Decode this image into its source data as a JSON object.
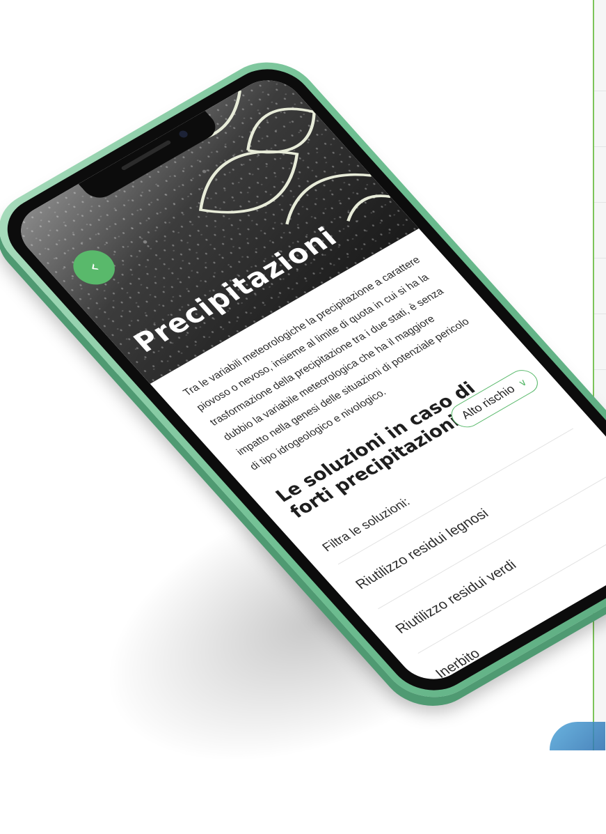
{
  "hero": {
    "title": "Precipitazioni",
    "back_icon": "chevron-left-icon"
  },
  "intro": "Tra le variabili meteorologiche la precipitazione a carattere piovoso o nevoso, insieme al limite di quota in cui si ha la trasformazione della precipitazione tra i due stati, è senza dubbio la variabile meteorologica che ha il maggiore impatto nella genesi delle situazioni di potenziale pericolo di tipo idrogeologico e nivologico.",
  "section": {
    "title": "Le soluzioni in caso di forti precipitazioni:",
    "risk_filter": {
      "label": "Alto rischio",
      "icon": "chevron-down-icon"
    }
  },
  "filter": {
    "label": "Filtra le soluzioni:",
    "items": [
      "Riutilizzo residui legnosi",
      "Riutilizzo residui verdi",
      "Inerbito"
    ]
  },
  "colors": {
    "accent": "#59b96b",
    "phone_body": "#6fbf92",
    "page_bg": "#ffffff"
  }
}
